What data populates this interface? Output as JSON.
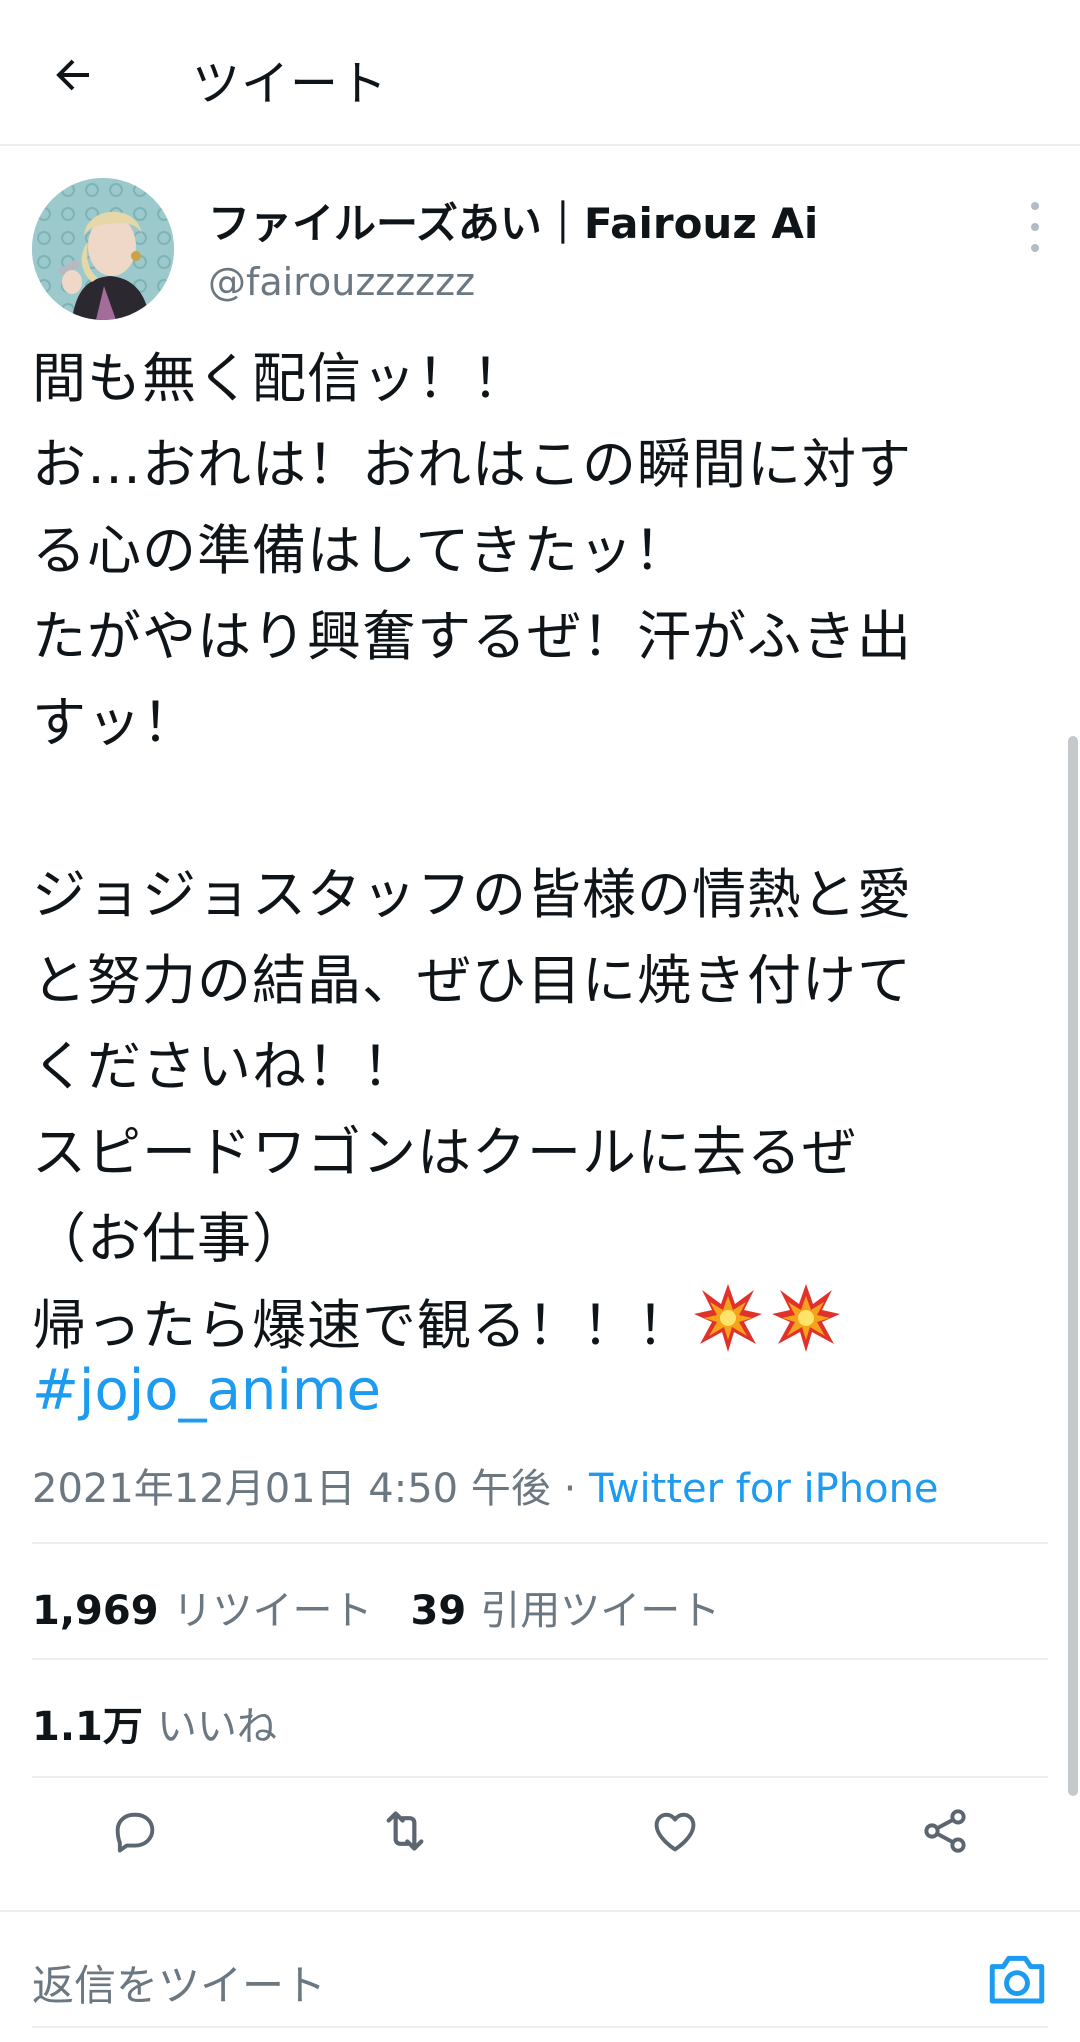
{
  "header": {
    "title": "ツイート",
    "back_icon": "arrow-left-icon"
  },
  "author": {
    "display_name": "ファイルーズあい｜Fairouz Ai",
    "handle": "@fairouzzzzzz",
    "more_icon": "more-vertical-icon"
  },
  "tweet": {
    "lines": [
      "間も無く配信ッ！！",
      "お…おれは！おれはこの瞬間に対す",
      "る心の準備はしてきたッ！",
      "たがやはり興奮するぜ！汗がふき出",
      "すッ！",
      "",
      "ジョジョスタッフの皆様の情熱と愛",
      "と努力の結晶、ぜひ目に焼き付けて",
      "くださいね！！",
      "スピードワゴンはクールに去るぜ",
      "（お仕事）",
      "帰ったら爆速で観る！！！"
    ],
    "emojis": [
      "collision-emoji",
      "collision-emoji"
    ],
    "hashtag": "#jojo_anime",
    "timestamp": "2021年12月01日 4:50 午後",
    "separator": " · ",
    "source": "Twitter for iPhone"
  },
  "stats": {
    "retweets_count": "1,969",
    "retweets_label": "リツイート",
    "quotes_count": "39",
    "quotes_label": "引用ツイート",
    "likes_count": "1.1万",
    "likes_label": "いいね"
  },
  "actions": [
    "reply-icon",
    "retweet-icon",
    "like-icon",
    "share-icon"
  ],
  "reply": {
    "placeholder": "返信をツイート",
    "camera_icon": "camera-icon"
  },
  "colors": {
    "accent": "#1d9bf0",
    "secondary_text": "#6b7781",
    "divider": "#eceef0"
  }
}
